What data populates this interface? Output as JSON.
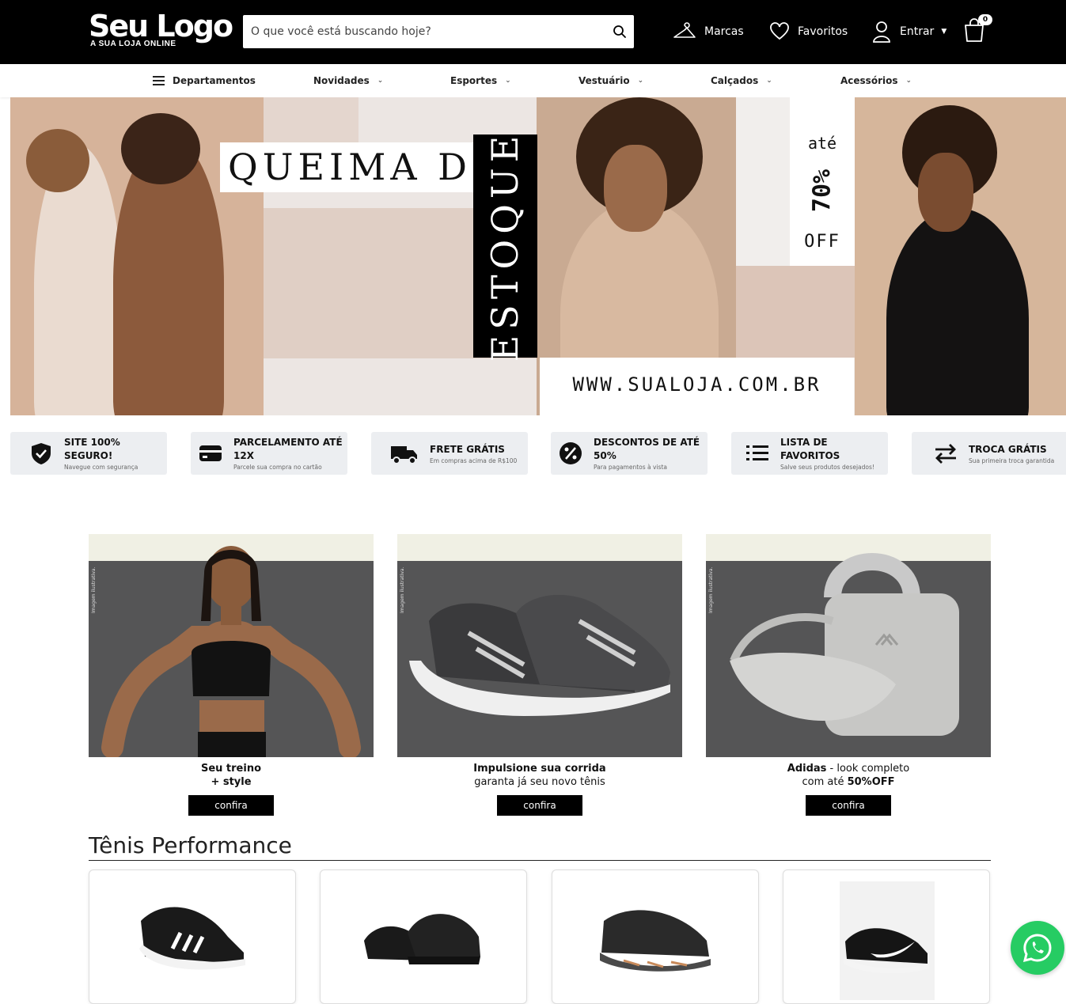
{
  "header": {
    "logo_main": "Seu Logo",
    "logo_sub": "A SUA LOJA ONLINE",
    "search_placeholder": "O que você está buscando hoje?",
    "brands_label": "Marcas",
    "favorites_label": "Favoritos",
    "login_label": "Entrar",
    "cart_count": "0"
  },
  "nav": {
    "items": [
      {
        "label": "Departamentos",
        "icon": "menu-icon"
      },
      {
        "label": "Novidades"
      },
      {
        "label": "Esportes"
      },
      {
        "label": "Vestuário"
      },
      {
        "label": "Calçados"
      },
      {
        "label": "Acessórios"
      }
    ]
  },
  "hero": {
    "title_line1": "QUEIMA DE",
    "title_line2": "ESTOQUE",
    "promo_ate": "até",
    "promo_pct": "70%",
    "promo_off": "OFF",
    "url": "WWW.SUALOJA.COM.BR"
  },
  "features": [
    {
      "title": "SITE 100% SEGURO!",
      "sub": "Navegue com segurança",
      "icon": "shield-check-icon"
    },
    {
      "title": "PARCELAMENTO ATÉ 12X",
      "sub": "Parcele sua compra no cartão",
      "icon": "credit-card-icon"
    },
    {
      "title": "FRETE GRÁTIS",
      "sub": "Em compras acima de R$100",
      "icon": "truck-icon"
    },
    {
      "title": "DESCONTOS DE ATÉ 50%",
      "sub": "Para pagamentos à vista",
      "icon": "percent-badge-icon"
    },
    {
      "title": "LISTA DE FAVORITOS",
      "sub": "Salve seus produtos desejados!",
      "icon": "list-icon"
    },
    {
      "title": "TROCA GRÁTIS",
      "sub": "Sua primeira troca garantida",
      "icon": "exchange-arrows-icon"
    }
  ],
  "categories": [
    {
      "line1_bold": "Seu treino",
      "line1_rest": "",
      "line2_pre": "",
      "line2_bold": "+ style",
      "button": "confira",
      "tag": "Imagem ilustrativa."
    },
    {
      "line1_bold": "Impulsione sua corrida",
      "line1_rest": "",
      "line2_pre": "garanta já seu novo tênis",
      "line2_bold": "",
      "button": "confira",
      "tag": "Imagem ilustrativa."
    },
    {
      "line1_bold": "Adidas",
      "line1_rest": " - look completo",
      "line2_pre": "com até ",
      "line2_bold": "50%OFF",
      "button": "confira",
      "tag": "Imagem ilustrativa."
    }
  ],
  "section": {
    "title": "Tênis Performance"
  },
  "colors": {
    "header_bg": "#000000",
    "feature_bg": "#eceef1",
    "whatsapp": "#26cc63"
  }
}
